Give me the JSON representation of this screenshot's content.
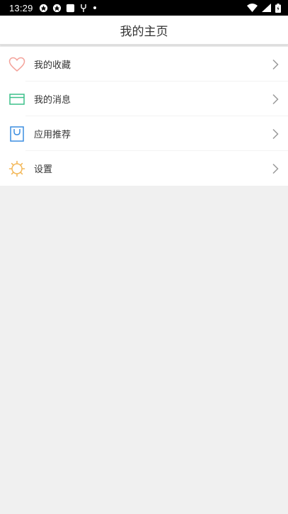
{
  "status_bar": {
    "time": "13:29",
    "left_icons": [
      "sync-icon",
      "sync-icon",
      "notification-square-icon",
      "usb-icon",
      "dot-icon"
    ],
    "right_icons": [
      "wifi-icon",
      "signal-icon",
      "battery-icon"
    ]
  },
  "header": {
    "title": "我的主页"
  },
  "menu": {
    "items": [
      {
        "label": "我的收藏",
        "icon": "heart-icon",
        "color": "#f4a29a"
      },
      {
        "label": "我的消息",
        "icon": "envelope-icon",
        "color": "#3cc08a"
      },
      {
        "label": "应用推荐",
        "icon": "shopping-bag-icon",
        "color": "#3b8de0"
      },
      {
        "label": "设置",
        "icon": "gear-icon",
        "color": "#f3b85a"
      }
    ],
    "chevron_icon": "chevron-right-icon"
  },
  "colors": {
    "background": "#f0f0f0",
    "status_bar": "#000000",
    "header_bg": "#ffffff",
    "chevron": "#9a9a9a"
  }
}
